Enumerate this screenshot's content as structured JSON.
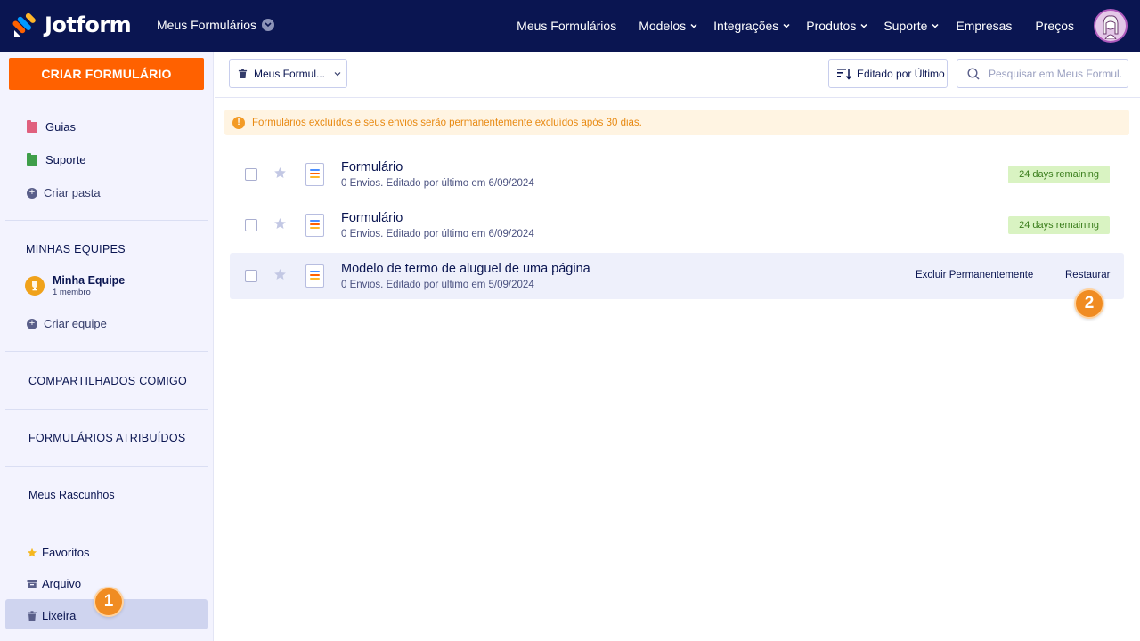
{
  "topnav": {
    "brand": "Jotform",
    "workspace": "Meus Formulários",
    "items": [
      {
        "label": "Meus Formulários",
        "chevron": false
      },
      {
        "label": "Modelos",
        "chevron": true
      },
      {
        "label": "Integrações",
        "chevron": true
      },
      {
        "label": "Produtos",
        "chevron": true
      },
      {
        "label": "Suporte",
        "chevron": true
      },
      {
        "label": "Empresas",
        "chevron": false
      },
      {
        "label": "Preços",
        "chevron": false
      }
    ]
  },
  "sidebar": {
    "create_label": "CRIAR FORMULÁRIO",
    "folders": [
      {
        "label": "Guias",
        "color": "#e0607e"
      },
      {
        "label": "Suporte",
        "color": "#3f9e4a"
      }
    ],
    "create_folder": "Criar pasta",
    "teams_title": "MINHAS EQUIPES",
    "team": {
      "name": "Minha Equipe",
      "members": "1 membro"
    },
    "create_team": "Criar equipe",
    "shared_title": "COMPARTILHADOS COMIGO",
    "assigned_title": "FORMULÁRIOS ATRIBUÍDOS",
    "drafts": "Meus Rascunhos",
    "favorites": "Favoritos",
    "archive": "Arquivo",
    "trash": "Lixeira"
  },
  "toolbar": {
    "folder_label": "Meus Formul...",
    "sort_label": "Editado por Último",
    "search_placeholder": "Pesquisar em Meus Formul..."
  },
  "alert": {
    "text": "Formulários excluídos e seus envios serão permanentemente excluídos após 30 dias."
  },
  "forms": [
    {
      "title": "Formulário",
      "meta": "0 Envios. Editado por último em 6/09/2024",
      "status": "24 days remaining"
    },
    {
      "title": "Formulário",
      "meta": "0 Envios. Editado por último em 6/09/2024",
      "status": "24 days remaining"
    },
    {
      "title": "Modelo de termo de aluguel de uma página",
      "meta": "0 Envios. Editado por último em 5/09/2024",
      "delete_label": "Excluir Permanentemente",
      "restore_label": "Restaurar"
    }
  ],
  "markers": {
    "one": "1",
    "two": "2"
  },
  "colors": {
    "nav_bg": "#0a1551",
    "accent": "#ff6100",
    "marker": "#f08c22",
    "status_bg": "#d9f3c2"
  }
}
